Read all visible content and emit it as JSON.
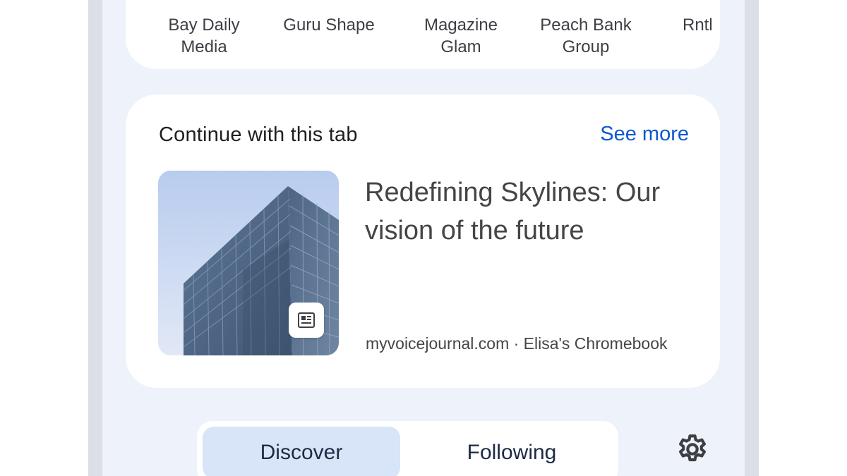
{
  "shortcuts": {
    "items": [
      {
        "label": "Bay Daily\nMedia"
      },
      {
        "label": "Guru Shape"
      },
      {
        "label": "Magazine\nGlam"
      },
      {
        "label": "Peach Bank\nGroup"
      },
      {
        "label": "Rntl"
      }
    ]
  },
  "continue_card": {
    "title": "Continue with this tab",
    "see_more": "See more",
    "article": {
      "headline": "Redefining Skylines: Our vision of the future",
      "source": "myvoicejournal.com · Elisa's Chromebook",
      "thumbnail_icon": "building-photo",
      "badge_icon": "article-icon"
    }
  },
  "feed_tabs": {
    "items": [
      {
        "label": "Discover",
        "selected": true
      },
      {
        "label": "Following",
        "selected": false
      }
    ],
    "settings_icon": "gear-icon"
  },
  "colors": {
    "background": "#eef2fb",
    "card": "#ffffff",
    "link": "#0b57d0",
    "selected_tab": "#d8e4f8",
    "text_primary": "#1f1f1f"
  }
}
